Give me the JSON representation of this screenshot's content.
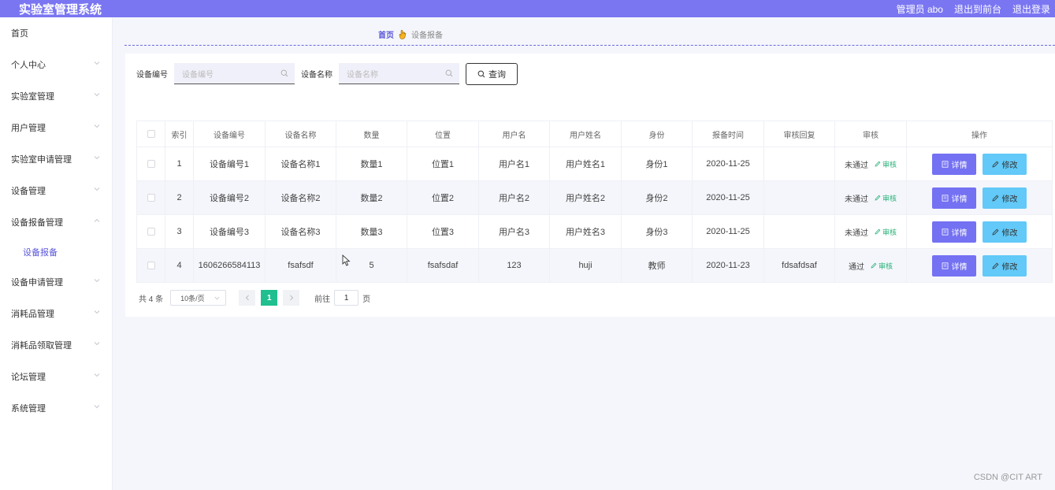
{
  "app": {
    "title": "实验室管理系统",
    "admin_label": "管理员 abo",
    "back_front": "退出到前台",
    "logout": "退出登录"
  },
  "sidebar": {
    "items": [
      {
        "label": "首页"
      },
      {
        "label": "个人中心"
      },
      {
        "label": "实验室管理"
      },
      {
        "label": "用户管理"
      },
      {
        "label": "实验室申请管理"
      },
      {
        "label": "设备管理"
      },
      {
        "label": "设备报备管理"
      },
      {
        "label": "设备申请管理"
      },
      {
        "label": "消耗品管理"
      },
      {
        "label": "消耗品领取管理"
      },
      {
        "label": "论坛管理"
      },
      {
        "label": "系统管理"
      }
    ],
    "sub_active": "设备报备"
  },
  "breadcrumb": {
    "home": "首页",
    "current": "设备报备"
  },
  "search": {
    "label1": "设备编号",
    "placeholder1": "设备编号",
    "label2": "设备名称",
    "placeholder2": "设备名称",
    "query": "查询"
  },
  "table": {
    "headers": [
      "索引",
      "设备编号",
      "设备名称",
      "数量",
      "位置",
      "用户名",
      "用户姓名",
      "身份",
      "报备时间",
      "审核回复",
      "审核",
      "操作"
    ],
    "rows": [
      {
        "idx": "1",
        "code": "设备编号1",
        "name": "设备名称1",
        "qty": "数量1",
        "loc": "位置1",
        "user": "用户名1",
        "realname": "用户姓名1",
        "role": "身份1",
        "time": "2020-11-25",
        "reply": "",
        "status": "未通过"
      },
      {
        "idx": "2",
        "code": "设备编号2",
        "name": "设备名称2",
        "qty": "数量2",
        "loc": "位置2",
        "user": "用户名2",
        "realname": "用户姓名2",
        "role": "身份2",
        "time": "2020-11-25",
        "reply": "",
        "status": "未通过"
      },
      {
        "idx": "3",
        "code": "设备编号3",
        "name": "设备名称3",
        "qty": "数量3",
        "loc": "位置3",
        "user": "用户名3",
        "realname": "用户姓名3",
        "role": "身份3",
        "time": "2020-11-25",
        "reply": "",
        "status": "未通过"
      },
      {
        "idx": "4",
        "code": "1606266584113",
        "name": "fsafsdf",
        "qty": "5",
        "loc": "fsafsdaf",
        "user": "123",
        "realname": "huji",
        "role": "教师",
        "time": "2020-11-23",
        "reply": "fdsafdsaf",
        "status": "通过"
      }
    ],
    "audit_link": "审核",
    "detail_btn": "详情",
    "edit_btn": "修改"
  },
  "pagination": {
    "total": "共 4 条",
    "page_size": "10条/页",
    "current_page": "1",
    "goto_prefix": "前往",
    "goto_value": "1",
    "goto_suffix": "页"
  },
  "watermark": "CSDN @CIT ART",
  "colors": {
    "topbar": "#7a76f2",
    "accent": "#5a56d8",
    "detail_button": "#7471f3",
    "edit_button": "#62c9f8",
    "page_active": "#1fbf8f",
    "audit_link": "#29b37b"
  }
}
